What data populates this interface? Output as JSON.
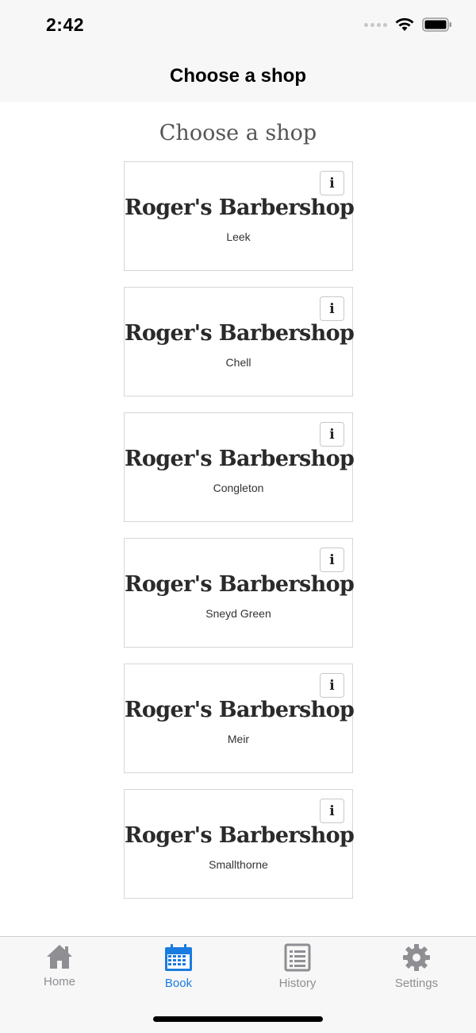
{
  "status_bar": {
    "time": "2:42"
  },
  "nav": {
    "title": "Choose a shop"
  },
  "page": {
    "heading": "Choose a shop"
  },
  "info_glyph": "i",
  "shops": [
    {
      "name": "Roger's Barbershop",
      "location": "Leek"
    },
    {
      "name": "Roger's Barbershop",
      "location": "Chell"
    },
    {
      "name": "Roger's Barbershop",
      "location": "Congleton"
    },
    {
      "name": "Roger's Barbershop",
      "location": "Sneyd Green"
    },
    {
      "name": "Roger's Barbershop",
      "location": "Meir"
    },
    {
      "name": "Roger's Barbershop",
      "location": "Smallthorne"
    }
  ],
  "tabs": [
    {
      "label": "Home",
      "icon": "home-icon"
    },
    {
      "label": "Book",
      "icon": "calendar-icon",
      "active": true
    },
    {
      "label": "History",
      "icon": "list-icon"
    },
    {
      "label": "Settings",
      "icon": "gear-icon"
    }
  ],
  "colors": {
    "active_tab": "#1a7be0",
    "inactive_tab": "#8e8e93"
  }
}
